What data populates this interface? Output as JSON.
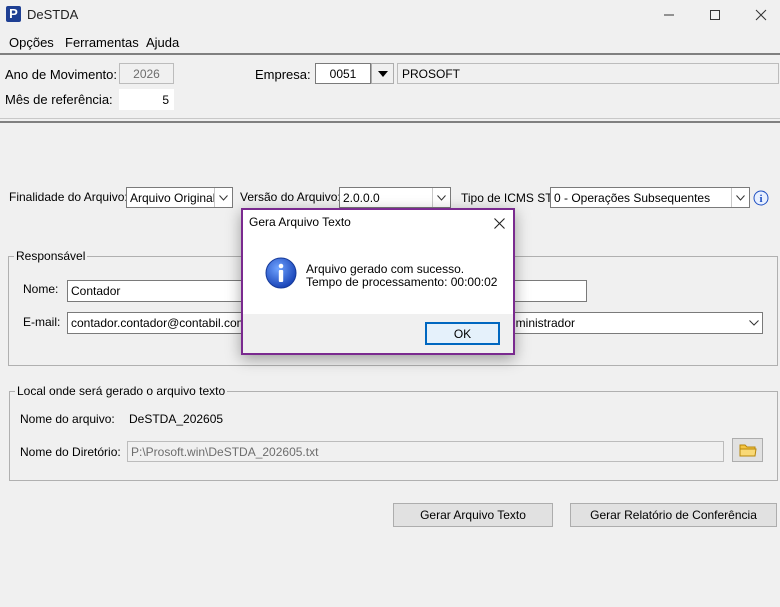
{
  "window": {
    "title": "DeSTDA",
    "app_icon_letter": "P"
  },
  "menu": [
    "Opções",
    "Ferramentas",
    "Ajuda"
  ],
  "header": {
    "ano_label": "Ano de Movimento:",
    "ano_value": "2026",
    "mes_label": "Mês de referência:",
    "mes_value": "5",
    "empresa_label": "Empresa:",
    "empresa_code": "0051",
    "empresa_name": "PROSOFT"
  },
  "options": {
    "finalidade_label": "Finalidade do Arquivo:",
    "finalidade_value": "Arquivo Original",
    "versao_label": "Versão do Arquivo:",
    "versao_value": "2.0.0.0",
    "icms_label": "Tipo de ICMS ST:",
    "icms_value": "0 - Operações Subsequentes"
  },
  "responsavel": {
    "legend": "Responsável",
    "nome_label": "Nome:",
    "nome_value": "Contador",
    "email_label": "E-mail:",
    "email_value": "contador.contador@contabil.com",
    "cargo_value": "dministrador"
  },
  "local": {
    "legend": "Local onde será gerado o arquivo texto",
    "arquivo_label": "Nome do arquivo:",
    "arquivo_value": "DeSTDA_202605",
    "diretorio_label": "Nome do Diretório:",
    "diretorio_value": "P:\\Prosoft.win\\DeSTDA_202605.txt"
  },
  "buttons": {
    "gerar": "Gerar Arquivo Texto",
    "relatorio": "Gerar Relatório de Conferência"
  },
  "dialog": {
    "title": "Gera Arquivo Texto",
    "line1": "Arquivo gerado com sucesso.",
    "line2": "Tempo de processamento: 00:00:02",
    "ok": "OK"
  },
  "colors": {
    "dialog_border": "#7a2a8f",
    "info_icon": "#1e4fc2",
    "app_icon": "#1e3f93"
  }
}
